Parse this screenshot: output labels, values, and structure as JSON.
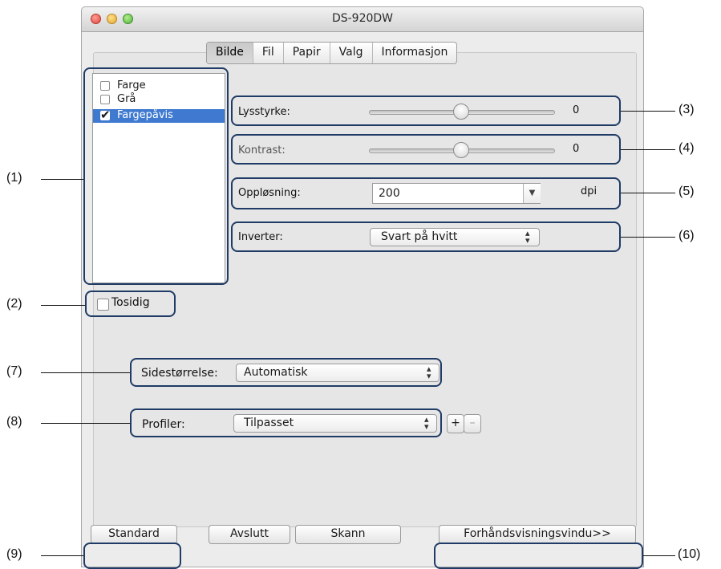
{
  "window": {
    "title": "DS-920DW"
  },
  "tabs": [
    {
      "label": "Bilde",
      "active": true
    },
    {
      "label": "Fil",
      "active": false
    },
    {
      "label": "Papir",
      "active": false
    },
    {
      "label": "Valg",
      "active": false
    },
    {
      "label": "Informasjon",
      "active": false
    }
  ],
  "color_mode_list": [
    {
      "label": "Farge",
      "checked": false,
      "selected": false
    },
    {
      "label": "Grå",
      "checked": false,
      "selected": false
    },
    {
      "label": "Fargepåvis",
      "checked": true,
      "selected": true
    }
  ],
  "brightness": {
    "label": "Lysstyrke:",
    "value": "0"
  },
  "contrast": {
    "label": "Kontrast:",
    "value": "0"
  },
  "resolution": {
    "label": "Oppløsning:",
    "value": "200",
    "unit": "dpi"
  },
  "invert": {
    "label": "Inverter:",
    "value": "Svart på hvitt"
  },
  "duplex": {
    "label": "Tosidig",
    "checked": false
  },
  "page_size": {
    "label": "Sidestørrelse:",
    "value": "Automatisk"
  },
  "profiles": {
    "label": "Profiler:",
    "value": "Tilpasset",
    "add": "+",
    "remove": "–"
  },
  "buttons": {
    "standard": "Standard",
    "quit": "Avslutt",
    "scan": "Skann",
    "preview": "Forhåndsvisningsvindu>>"
  },
  "annotations": {
    "a1": "(1)",
    "a2": "(2)",
    "a3": "(3)",
    "a4": "(4)",
    "a5": "(5)",
    "a6": "(6)",
    "a7": "(7)",
    "a8": "(8)",
    "a9": "(9)",
    "a10": "(10)"
  },
  "colors": {
    "selection": "#3f7ad0",
    "callout": "#1f3b66"
  }
}
